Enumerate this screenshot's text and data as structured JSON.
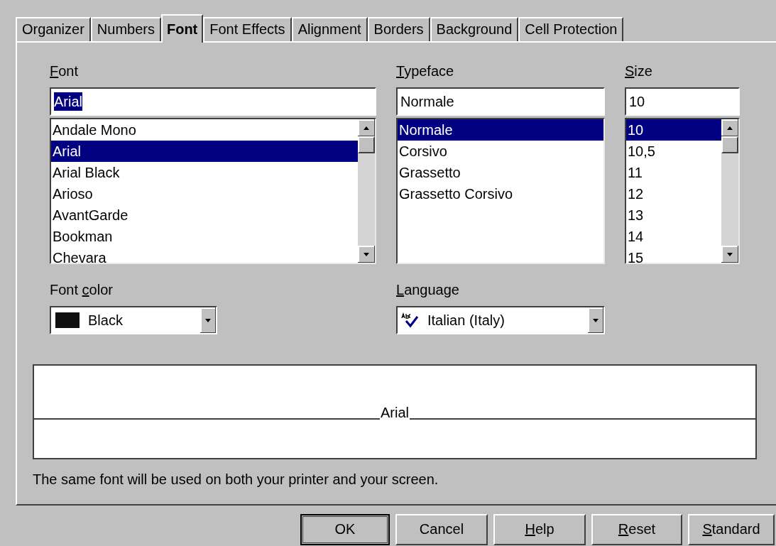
{
  "tabs": [
    {
      "label": "Organizer",
      "selected": false
    },
    {
      "label": "Numbers",
      "selected": false
    },
    {
      "label": "Font",
      "selected": true
    },
    {
      "label": "Font Effects",
      "selected": false
    },
    {
      "label": "Alignment",
      "selected": false
    },
    {
      "label": "Borders",
      "selected": false
    },
    {
      "label": "Background",
      "selected": false
    },
    {
      "label": "Cell Protection",
      "selected": false
    }
  ],
  "font": {
    "label": [
      {
        "text": "F",
        "underlined": true
      },
      {
        "text": "ont",
        "underlined": false
      }
    ],
    "value": "Arial",
    "text_selected": true,
    "scrollbar": true,
    "items": [
      {
        "label": "Andale Mono",
        "selected": false
      },
      {
        "label": "Arial",
        "selected": true
      },
      {
        "label": "Arial Black",
        "selected": false
      },
      {
        "label": "Arioso",
        "selected": false
      },
      {
        "label": "AvantGarde",
        "selected": false
      },
      {
        "label": "Bookman",
        "selected": false
      },
      {
        "label": "Chevara",
        "selected": false
      }
    ]
  },
  "typeface": {
    "label": [
      {
        "text": "T",
        "underlined": true
      },
      {
        "text": "ypeface",
        "underlined": false
      }
    ],
    "value": "Normale",
    "text_selected": false,
    "scrollbar": false,
    "items": [
      {
        "label": "Normale",
        "selected": true
      },
      {
        "label": "Corsivo",
        "selected": false
      },
      {
        "label": "Grassetto",
        "selected": false
      },
      {
        "label": "Grassetto Corsivo",
        "selected": false
      }
    ]
  },
  "size": {
    "label": [
      {
        "text": "S",
        "underlined": true
      },
      {
        "text": "ize",
        "underlined": false
      }
    ],
    "value": "10",
    "text_selected": false,
    "scrollbar": true,
    "items": [
      {
        "label": "10",
        "selected": true
      },
      {
        "label": "10,5",
        "selected": false
      },
      {
        "label": "11",
        "selected": false
      },
      {
        "label": "12",
        "selected": false
      },
      {
        "label": "13",
        "selected": false
      },
      {
        "label": "14",
        "selected": false
      },
      {
        "label": "15",
        "selected": false
      }
    ]
  },
  "font_color": {
    "label": [
      {
        "text": "Font ",
        "underlined": false
      },
      {
        "text": "c",
        "underlined": true
      },
      {
        "text": "olor",
        "underlined": false
      }
    ],
    "value": "Black",
    "color": "#101010"
  },
  "language": {
    "label": [
      {
        "text": "L",
        "underlined": true
      },
      {
        "text": "anguage",
        "underlined": false
      }
    ],
    "value": "Italian (Italy)"
  },
  "preview": {
    "text": "Arial"
  },
  "note": "The same font will be used on both your printer and your screen.",
  "buttons": [
    {
      "label": [
        {
          "text": "OK",
          "underlined": false
        }
      ],
      "default": true
    },
    {
      "label": [
        {
          "text": "Cancel",
          "underlined": false
        }
      ],
      "default": false
    },
    {
      "label": [
        {
          "text": "H",
          "underlined": true
        },
        {
          "text": "elp",
          "underlined": false
        }
      ],
      "default": false
    },
    {
      "label": [
        {
          "text": "R",
          "underlined": true
        },
        {
          "text": "eset",
          "underlined": false
        }
      ],
      "default": false
    },
    {
      "label": [
        {
          "text": "S",
          "underlined": true
        },
        {
          "text": "tandard",
          "underlined": false
        }
      ],
      "default": false
    }
  ]
}
